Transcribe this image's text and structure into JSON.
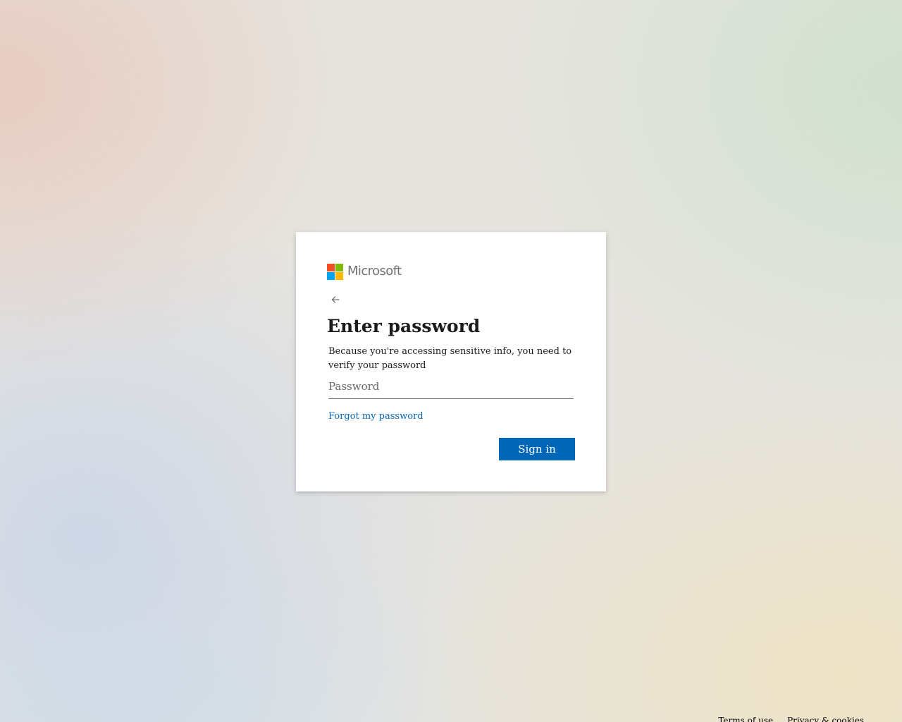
{
  "brand": {
    "name": "Microsoft",
    "logo_colors": [
      "#f25022",
      "#7fba00",
      "#00a4ef",
      "#ffb900"
    ]
  },
  "signin": {
    "back_icon": "arrow-left-icon",
    "title": "Enter password",
    "description": "Because you're accessing sensitive info, you need to verify your password",
    "password_placeholder": "Password",
    "password_value": "",
    "forgot_label": "Forgot my password",
    "submit_label": "Sign in"
  },
  "footer": {
    "terms_label": "Terms of use",
    "privacy_label": "Privacy & cookies"
  },
  "colors": {
    "accent": "#0067b8",
    "text": "#1b1b1b"
  }
}
